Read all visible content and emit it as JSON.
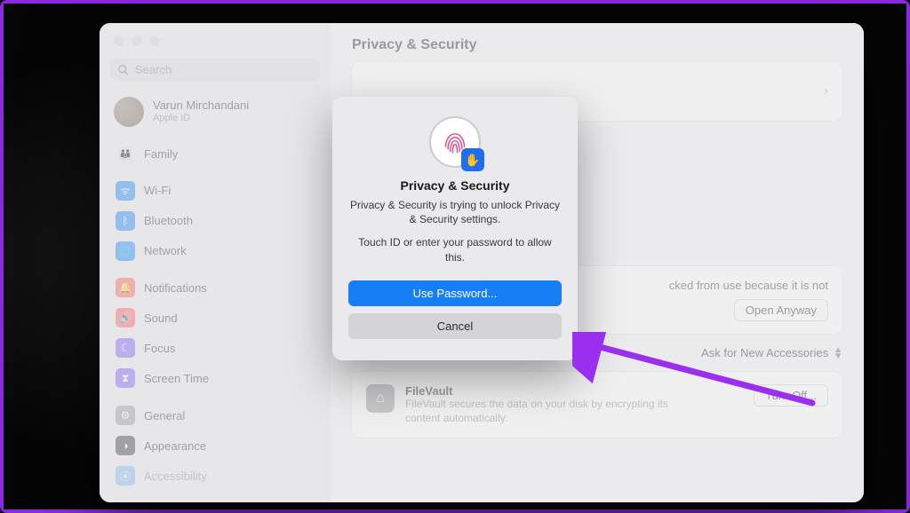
{
  "search": {
    "placeholder": "Search"
  },
  "user": {
    "name": "Varun Mirchandani",
    "sub": "Apple ID"
  },
  "sidebar": {
    "items": [
      {
        "label": "Family",
        "bg": "#c9e7ff",
        "glyph": "👪"
      },
      {
        "label": "Wi-Fi",
        "bg": "#1a82f6",
        "glyph": "📶"
      },
      {
        "label": "Bluetooth",
        "bg": "#1a82f6",
        "glyph": "ᛒ"
      },
      {
        "label": "Network",
        "bg": "#1a82f6",
        "glyph": "🌐"
      },
      {
        "label": "Notifications",
        "bg": "#ff4d4d",
        "glyph": "🔔"
      },
      {
        "label": "Sound",
        "bg": "#ff4d4d",
        "glyph": "🔊"
      },
      {
        "label": "Focus",
        "bg": "#7a5cf5",
        "glyph": "☾"
      },
      {
        "label": "Screen Time",
        "bg": "#7a5cf5",
        "glyph": "⏳"
      },
      {
        "label": "General",
        "bg": "#9a9a9e",
        "glyph": "⚙"
      },
      {
        "label": "Appearance",
        "bg": "#3a3a3c",
        "glyph": "◑"
      },
      {
        "label": "Accessibility",
        "bg": "#1a82f6",
        "glyph": "⦿"
      }
    ]
  },
  "page": {
    "title": "Privacy & Security",
    "blocked_text": "cked from use because it is not",
    "open_anyway": "Open Anyway",
    "accessories_label": "Ask for New Accessories",
    "filevault": {
      "title": "FileVault",
      "desc": "FileVault secures the data on your disk by encrypting its content automatically.",
      "button": "Turn Off..."
    }
  },
  "dialog": {
    "title": "Privacy & Security",
    "message": "Privacy & Security is trying to unlock Privacy & Security settings.",
    "message2": "Touch ID or enter your password to allow this.",
    "primary": "Use Password...",
    "secondary": "Cancel"
  }
}
